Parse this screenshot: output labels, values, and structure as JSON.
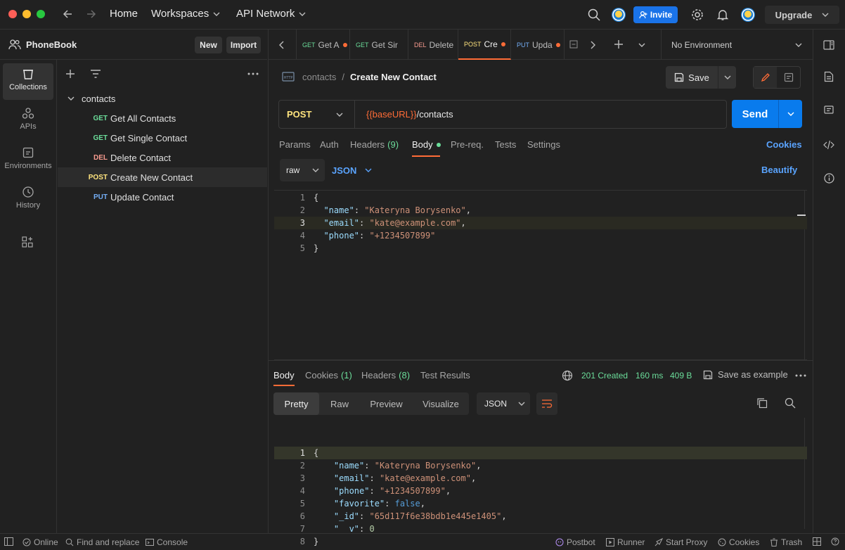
{
  "topbar": {
    "home": "Home",
    "workspaces": "Workspaces",
    "api_network": "API Network",
    "invite": "Invite",
    "upgrade": "Upgrade"
  },
  "sidebar": {
    "workspace_name": "PhoneBook",
    "new_label": "New",
    "import_label": "Import",
    "rail": [
      "Collections",
      "APIs",
      "Environments",
      "History"
    ],
    "collection_name": "contacts",
    "requests": [
      {
        "method": "GET",
        "name": "Get All Contacts",
        "color": "#6bdd9a"
      },
      {
        "method": "GET",
        "name": "Get Single Contact",
        "color": "#6bdd9a"
      },
      {
        "method": "DEL",
        "name": "Delete Contact",
        "color": "#f79a8e"
      },
      {
        "method": "POST",
        "name": "Create New Contact",
        "color": "#ffe47e"
      },
      {
        "method": "PUT",
        "name": "Update Contact",
        "color": "#74aef6"
      }
    ]
  },
  "tabs": [
    {
      "method": "GET",
      "label": "Get A",
      "color": "#6bdd9a",
      "dot": true
    },
    {
      "method": "GET",
      "label": "Get Sir",
      "color": "#6bdd9a",
      "dot": false
    },
    {
      "method": "DEL",
      "label": "Delete",
      "color": "#f79a8e",
      "dot": false
    },
    {
      "method": "POST",
      "label": "Cre",
      "color": "#ffe47e",
      "dot": true
    },
    {
      "method": "PUT",
      "label": "Upda",
      "color": "#74aef6",
      "dot": true
    }
  ],
  "environment": "No Environment",
  "request": {
    "breadcrumb_parent": "contacts",
    "breadcrumb_sep": "/",
    "title": "Create New Contact",
    "save": "Save",
    "method": "POST",
    "url_var": "{{baseURL}}",
    "url_path": "/contacts",
    "send": "Send",
    "tabs": {
      "params": "Params",
      "auth": "Auth",
      "headers": "Headers",
      "headers_count": "(9)",
      "body": "Body",
      "prereq": "Pre-req.",
      "tests": "Tests",
      "settings": "Settings",
      "cookies": "Cookies"
    },
    "body_mode": "raw",
    "body_lang": "JSON",
    "beautify": "Beautify",
    "body_lines": [
      {
        "n": "1",
        "t": "{"
      },
      {
        "n": "2",
        "k": "\"name\"",
        "v": "\"Kateryna Borysenko\""
      },
      {
        "n": "3",
        "k": "\"email\"",
        "v": "\"kate@example.com\""
      },
      {
        "n": "4",
        "k": "\"phone\"",
        "v": "\"+1234507899\""
      },
      {
        "n": "5",
        "t": "}"
      }
    ]
  },
  "response": {
    "tabs": {
      "body": "Body",
      "cookies": "Cookies",
      "cookies_count": "(1)",
      "headers": "Headers",
      "headers_count": "(8)",
      "test_results": "Test Results"
    },
    "status": "201 Created",
    "time": "160 ms",
    "size": "409 B",
    "save_example": "Save as example",
    "views": [
      "Pretty",
      "Raw",
      "Preview",
      "Visualize"
    ],
    "format": "JSON",
    "lines": [
      {
        "n": "1",
        "t": "{"
      },
      {
        "n": "2",
        "k": "\"name\"",
        "v": "\"Kateryna Borysenko\"",
        "c": ","
      },
      {
        "n": "3",
        "k": "\"email\"",
        "v": "\"kate@example.com\"",
        "c": ","
      },
      {
        "n": "4",
        "k": "\"phone\"",
        "v": "\"+1234507899\"",
        "c": ","
      },
      {
        "n": "5",
        "k": "\"favorite\"",
        "b": "false",
        "c": ","
      },
      {
        "n": "6",
        "k": "\"_id\"",
        "v": "\"65d117f6e38bdb1e445e1405\"",
        "c": ","
      },
      {
        "n": "7",
        "k": "\"__v\"",
        "num": "0",
        "c": ""
      },
      {
        "n": "8",
        "t": "}"
      }
    ]
  },
  "statusbar": {
    "online": "Online",
    "find_replace": "Find and replace",
    "console": "Console",
    "postbot": "Postbot",
    "runner": "Runner",
    "start_proxy": "Start Proxy",
    "cookies": "Cookies",
    "trash": "Trash"
  }
}
